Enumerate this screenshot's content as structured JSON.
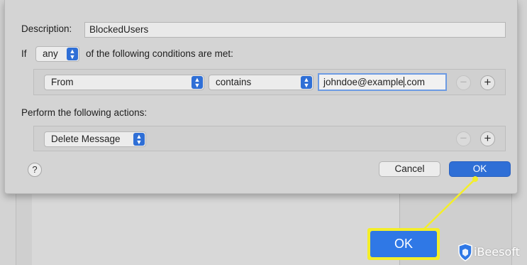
{
  "sheet": {
    "description_label": "Description:",
    "description_value": "BlockedUsers",
    "if_label": "If",
    "quantifier_value": "any",
    "conditions_label": "of the following conditions are met:",
    "actions_label": "Perform the following actions:"
  },
  "condition_row": {
    "field_value": "From",
    "operator_value": "contains",
    "value_before_caret": "johndoe@example",
    "value_after_caret": ".com",
    "remove_symbol": "−",
    "add_symbol": "+"
  },
  "action_row": {
    "action_value": "Delete Message",
    "remove_symbol": "−",
    "add_symbol": "+"
  },
  "footer": {
    "help_symbol": "?",
    "cancel_label": "Cancel",
    "ok_label": "OK"
  },
  "callout": {
    "ok_label": "OK",
    "highlight_color": "#f3ee2a"
  },
  "watermark": {
    "text": "iBeesoft",
    "icon": "shield-icon"
  },
  "colors": {
    "accent": "#2f6fd6",
    "callout_blue": "#2f78e6",
    "callout_yellow": "#f3ee2a"
  }
}
